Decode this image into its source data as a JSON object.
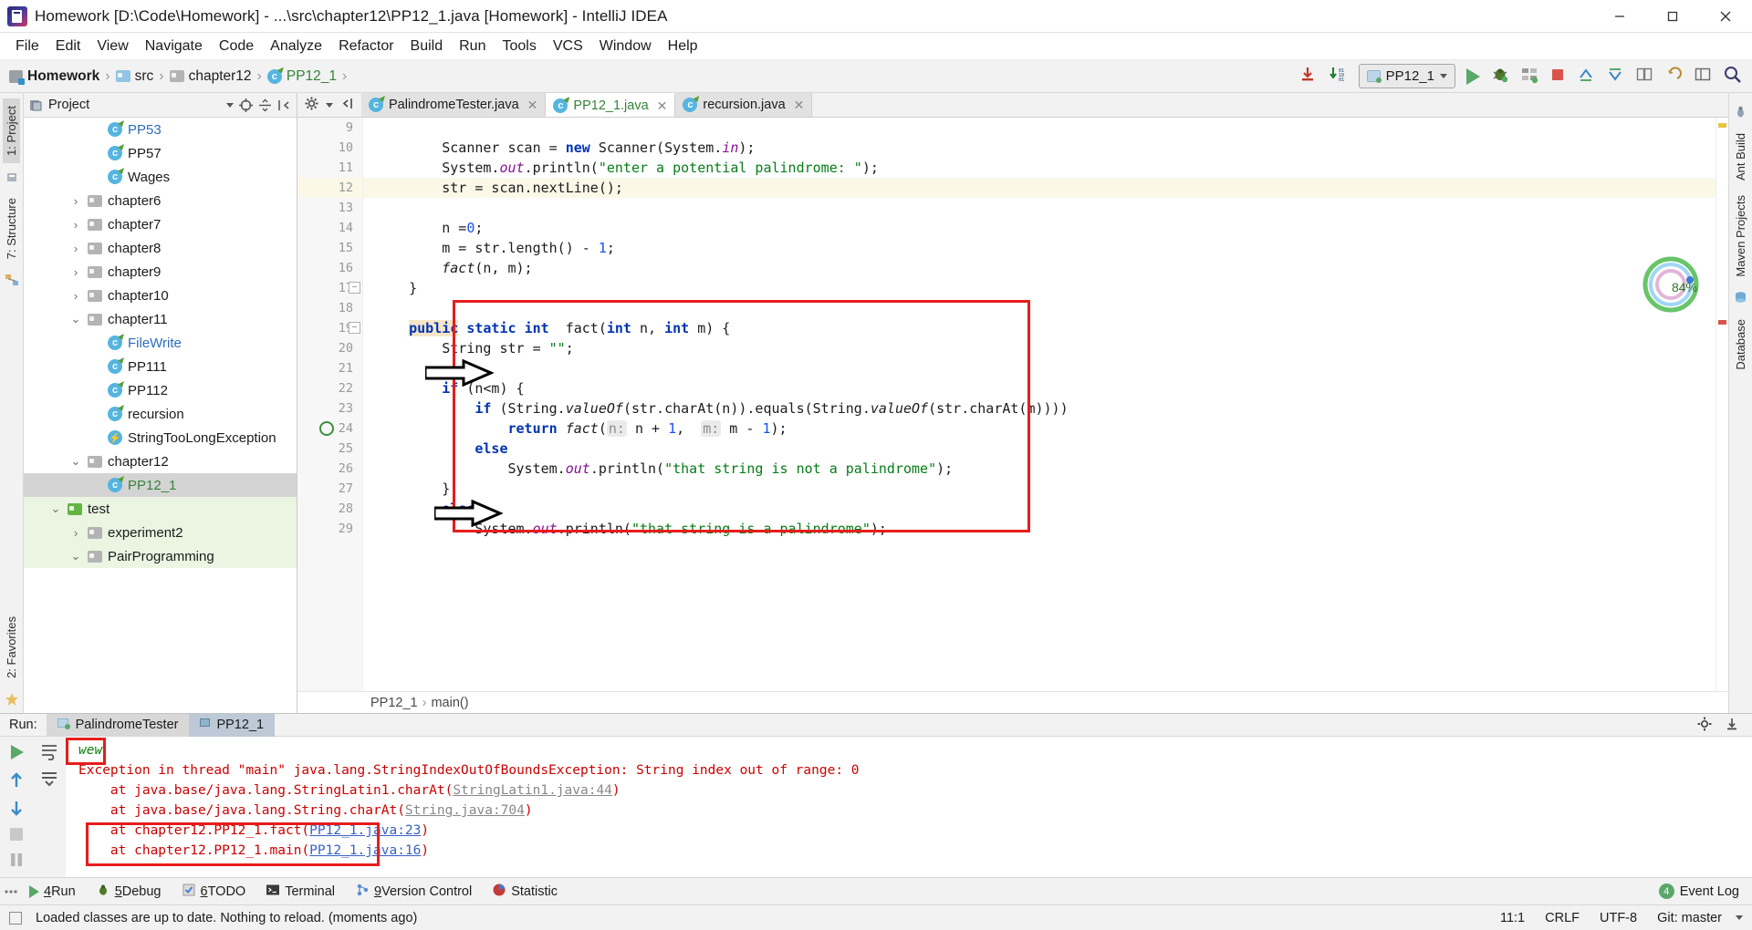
{
  "window": {
    "title": "Homework [D:\\Code\\Homework] - ...\\src\\chapter12\\PP12_1.java [Homework] - IntelliJ IDEA",
    "minimize": "—",
    "maximize": "❐",
    "close": "✕"
  },
  "menu": [
    "File",
    "Edit",
    "View",
    "Navigate",
    "Code",
    "Analyze",
    "Refactor",
    "Build",
    "Run",
    "Tools",
    "VCS",
    "Window",
    "Help"
  ],
  "breadcrumb": [
    {
      "label": "Homework",
      "icon": "module-icon"
    },
    {
      "label": "src",
      "icon": "folder-blue-icon"
    },
    {
      "label": "chapter12",
      "icon": "folder-grey-icon"
    },
    {
      "label": "PP12_1",
      "icon": "class-icon"
    }
  ],
  "toolbar": {
    "download_icon": "download-icon",
    "build_icon": "build-binary-icon",
    "run_config": "PP12_1",
    "run_icon": "run-icon",
    "debug_icon": "debug-icon",
    "coverage_icon": "coverage-icon",
    "stop_icon": "stop-icon",
    "vcs_update_icon": "vcs-update-icon",
    "vcs_commit_icon": "vcs-commit-icon",
    "vcs_diff_icon": "vcs-diff-icon",
    "undo_icon": "undo-icon",
    "layout_icon": "layout-icon",
    "search_icon": "search-icon"
  },
  "left_strip": {
    "tabs": [
      "1: Project",
      "7: Structure"
    ],
    "bottom_tabs": [
      "2: Favorites"
    ]
  },
  "right_strip": {
    "tabs": [
      "Ant Build",
      "Maven Projects",
      "Database"
    ]
  },
  "project_panel": {
    "title": "Project",
    "tree": [
      {
        "label": "PP53",
        "indent": 3,
        "arrow": "",
        "icon": "class-icon",
        "color": "blue"
      },
      {
        "label": "PP57",
        "indent": 3,
        "arrow": "",
        "icon": "class-icon",
        "color": ""
      },
      {
        "label": "Wages",
        "indent": 3,
        "arrow": "",
        "icon": "class-icon",
        "color": ""
      },
      {
        "label": "chapter6",
        "indent": 2,
        "arrow": "›",
        "icon": "folder-grey-icon",
        "color": ""
      },
      {
        "label": "chapter7",
        "indent": 2,
        "arrow": "›",
        "icon": "folder-grey-icon",
        "color": ""
      },
      {
        "label": "chapter8",
        "indent": 2,
        "arrow": "›",
        "icon": "folder-grey-icon",
        "color": ""
      },
      {
        "label": "chapter9",
        "indent": 2,
        "arrow": "›",
        "icon": "folder-grey-icon",
        "color": ""
      },
      {
        "label": "chapter10",
        "indent": 2,
        "arrow": "›",
        "icon": "folder-grey-icon",
        "color": ""
      },
      {
        "label": "chapter11",
        "indent": 2,
        "arrow": "⌄",
        "icon": "folder-grey-icon",
        "color": ""
      },
      {
        "label": "FileWrite",
        "indent": 3,
        "arrow": "",
        "icon": "class-icon",
        "color": "blue"
      },
      {
        "label": "PP111",
        "indent": 3,
        "arrow": "",
        "icon": "class-icon",
        "color": ""
      },
      {
        "label": "PP112",
        "indent": 3,
        "arrow": "",
        "icon": "class-icon",
        "color": ""
      },
      {
        "label": "recursion",
        "indent": 3,
        "arrow": "",
        "icon": "class-icon",
        "color": ""
      },
      {
        "label": "StringTooLongException",
        "indent": 3,
        "arrow": "",
        "icon": "exception-icon",
        "color": ""
      },
      {
        "label": "chapter12",
        "indent": 2,
        "arrow": "⌄",
        "icon": "folder-grey-icon",
        "color": ""
      },
      {
        "label": "PP12_1",
        "indent": 3,
        "arrow": "",
        "icon": "class-icon",
        "color": "green",
        "selected": true
      },
      {
        "label": "test",
        "indent": 1,
        "arrow": "⌄",
        "icon": "folder-green-icon",
        "color": "",
        "greenbg": true
      },
      {
        "label": "experiment2",
        "indent": 2,
        "arrow": "›",
        "icon": "folder-grey-icon",
        "color": "",
        "greenbg": true
      },
      {
        "label": "PairProgramming",
        "indent": 2,
        "arrow": "⌄",
        "icon": "folder-grey-icon",
        "color": "",
        "greenbg": true
      }
    ]
  },
  "editor": {
    "tabs": [
      {
        "label": "PalindromeTester.java",
        "active": false,
        "green": false
      },
      {
        "label": "PP12_1.java",
        "active": true,
        "green": true
      },
      {
        "label": "recursion.java",
        "active": false,
        "green": false
      }
    ],
    "first_line": 9,
    "current_line": 12,
    "lines": [
      {
        "n": 9,
        "html": ""
      },
      {
        "n": 10,
        "html": "        <span class=\"t\">Scanner scan = </span><span class=\"kw\">new</span><span class=\"t\"> Scanner(System.</span><span class=\"fld\">in</span><span class=\"t\">);</span>"
      },
      {
        "n": 11,
        "html": "        <span class=\"t\">System.</span><span class=\"fld\">out</span><span class=\"t\">.println(</span><span class=\"str\">\"enter a potential palindrome: \"</span><span class=\"t\">);</span>"
      },
      {
        "n": 12,
        "html": "        <span class=\"t\">str = scan.nextLine();</span>"
      },
      {
        "n": 13,
        "html": ""
      },
      {
        "n": 14,
        "html": "        <span class=\"t\">n =</span><span class=\"num\">0</span><span class=\"t\">;</span>"
      },
      {
        "n": 15,
        "html": "        <span class=\"t\">m = str.length() - </span><span class=\"num\">1</span><span class=\"t\">;</span>"
      },
      {
        "n": 16,
        "html": "        <span class=\"mtd\">fact</span><span class=\"t\">(n, m);</span>"
      },
      {
        "n": 17,
        "html": "    <span class=\"t\">}</span>"
      },
      {
        "n": 18,
        "html": ""
      },
      {
        "n": 19,
        "html": "    <span class=\"kw hl\">public</span><span class=\"t\"> </span><span class=\"kw\">static</span><span class=\"t\"> </span><span class=\"kw\">int</span><span class=\"t\">  fact(</span><span class=\"kw\">int</span><span class=\"t\"> n, </span><span class=\"kw\">int</span><span class=\"t\"> m) {</span>"
      },
      {
        "n": 20,
        "html": "        <span class=\"t\">String str = </span><span class=\"str\">\"\"</span><span class=\"t\">;</span>"
      },
      {
        "n": 21,
        "html": ""
      },
      {
        "n": 22,
        "html": "        <span class=\"kw\">if</span><span class=\"t\"> (n&lt;m) {</span>"
      },
      {
        "n": 23,
        "html": "            <span class=\"kw\">if</span><span class=\"t\"> (String.</span><span class=\"mtd\">valueOf</span><span class=\"t\">(str.charAt(n)).equals(String.</span><span class=\"mtd\">valueOf</span><span class=\"t\">(str.charAt(m))))</span>"
      },
      {
        "n": 24,
        "html": "                <span class=\"kw\">return</span><span class=\"t\"> </span><span class=\"mtd\">fact</span><span class=\"t\">(</span><span class=\"hintp\">n:</span><span class=\"t\"> n + </span><span class=\"num\">1</span><span class=\"t\">,  </span><span class=\"hintp\">m:</span><span class=\"t\"> m - </span><span class=\"num\">1</span><span class=\"t\">);</span>"
      },
      {
        "n": 25,
        "html": "            <span class=\"kw\">else</span>"
      },
      {
        "n": 26,
        "html": "                <span class=\"t\">System.</span><span class=\"fld\">out</span><span class=\"t\">.println(</span><span class=\"str\">\"that string is not a palindrome\"</span><span class=\"t\">);</span>"
      },
      {
        "n": 27,
        "html": "        <span class=\"t\">}</span>"
      },
      {
        "n": 28,
        "html": "        <span class=\"kw\">else</span>"
      },
      {
        "n": 29,
        "html": "            <span class=\"t\">System.</span><span class=\"fld\">out</span><span class=\"t\">.println(</span><span class=\"str\">\"that string is a palindrome\"</span><span class=\"t\">);</span>"
      }
    ],
    "breadcrumb_footer": [
      "PP12_1",
      "main()"
    ],
    "inspection_percent": "84%"
  },
  "run_panel": {
    "label": "Run:",
    "tabs": [
      {
        "label": "PalindromeTester",
        "active": false
      },
      {
        "label": "PP12_1",
        "active": true
      }
    ],
    "console": [
      {
        "text": "wew",
        "type": "output"
      },
      {
        "text": "Exception in thread \"main\" java.lang.StringIndexOutOfBoundsException: String index out of range: 0",
        "type": "error"
      },
      {
        "text": "    at java.base/java.lang.StringLatin1.charAt(StringLatin1.java:44)",
        "type": "error-link",
        "link": "StringLatin1.java:44"
      },
      {
        "text": "    at java.base/java.lang.String.charAt(String.java:704)",
        "type": "error-link",
        "link": "String.java:704"
      },
      {
        "text": "    at chapter12.PP12_1.fact(PP12_1.java:23)",
        "type": "error-link-blue",
        "link": "PP12_1.java:23"
      },
      {
        "text": "    at chapter12.PP12_1.main(PP12_1.java:16)",
        "type": "error-link-blue",
        "link": "PP12_1.java:16"
      }
    ],
    "side_icons": [
      "rerun-icon",
      "up-stacktrace-icon",
      "down-stacktrace-icon",
      "stop-icon",
      "pause-icon",
      "soft-wrap-icon",
      "camera-icon",
      "print-icon",
      "expand-icon"
    ]
  },
  "bottom_tabs": [
    {
      "num": "4",
      "label": "Run",
      "icon": "run-icon"
    },
    {
      "num": "5",
      "label": "Debug",
      "icon": "debug-icon"
    },
    {
      "num": "6",
      "label": "TODO",
      "icon": "todo-icon"
    },
    {
      "num": "",
      "label": "Terminal",
      "icon": "terminal-icon"
    },
    {
      "num": "9",
      "label": "Version Control",
      "icon": "vcs-icon"
    },
    {
      "num": "",
      "label": "Statistic",
      "icon": "statistic-icon"
    }
  ],
  "event_log": {
    "count": "4",
    "label": "Event Log"
  },
  "statusbar": {
    "message": "Loaded classes are up to date. Nothing to reload. (moments ago)",
    "caret": "11:1",
    "line_sep": "CRLF",
    "encoding": "UTF-8",
    "branch": "Git: master"
  },
  "colors": {
    "accent_red": "#e81c1c",
    "keyword_blue": "#0033b3",
    "string_green": "#067d17",
    "error_red": "#cc0000",
    "selection_grey": "#d4d4d4"
  }
}
